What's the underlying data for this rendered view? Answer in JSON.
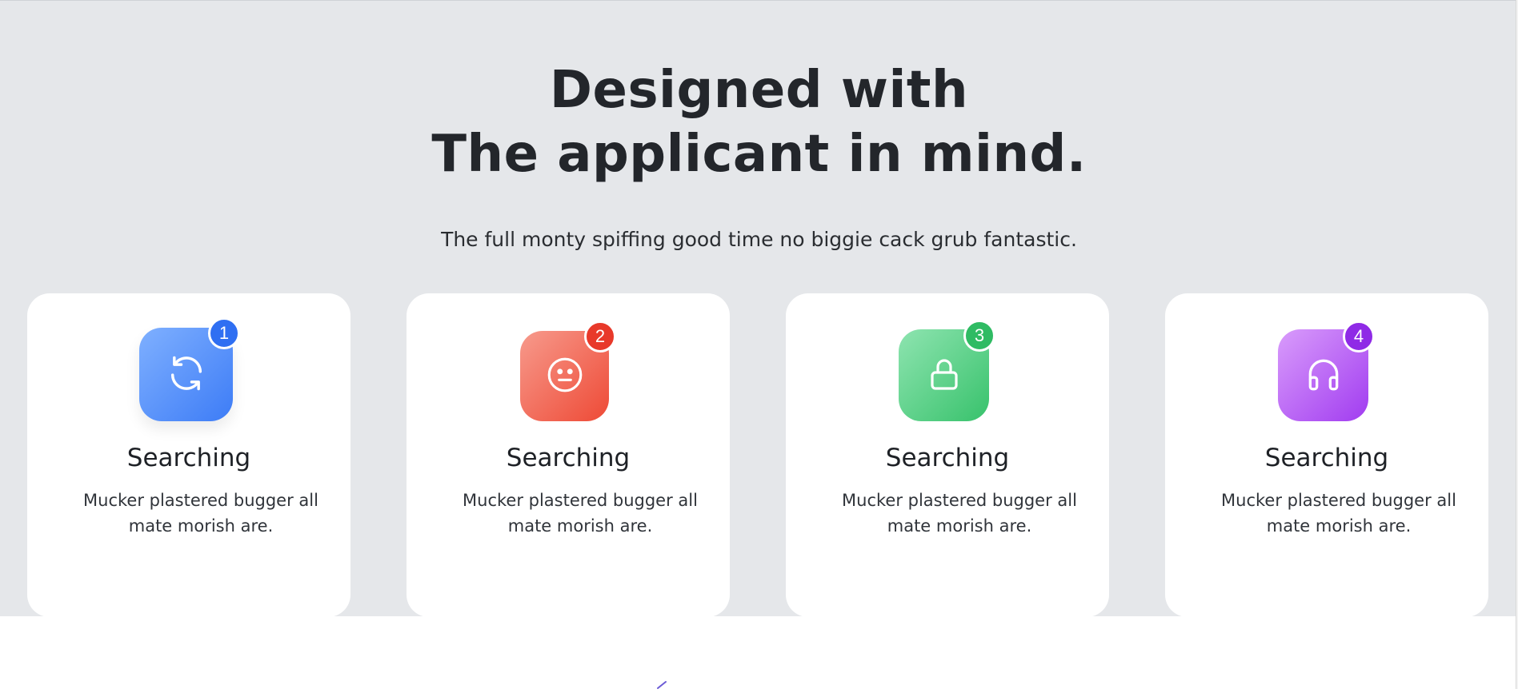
{
  "hero": {
    "title_line1": "Designed with",
    "title_line2": "The applicant in mind.",
    "subtitle": "The full monty spiffing good time no biggie cack grub fantastic."
  },
  "cards": [
    {
      "badge": "1",
      "title": "Searching",
      "text": "Mucker plastered bugger all mate morish are.",
      "icon": "refresh-icon",
      "color_from": "#7fb0ff",
      "color_to": "#3d7cf6",
      "badge_color": "#2f6ff2"
    },
    {
      "badge": "2",
      "title": "Searching",
      "text": "Mucker plastered bugger all mate morish are.",
      "icon": "neutral-face-icon",
      "color_from": "#f79a8c",
      "color_to": "#ee4a36",
      "badge_color": "#e8392a"
    },
    {
      "badge": "3",
      "title": "Searching",
      "text": "Mucker plastered bugger all mate morish are.",
      "icon": "lock-icon",
      "color_from": "#8ee4b0",
      "color_to": "#38c26c",
      "badge_color": "#2fbb63"
    },
    {
      "badge": "4",
      "title": "Searching",
      "text": "Mucker plastered bugger all mate morish are.",
      "icon": "headphones-icon",
      "color_from": "#d99cfb",
      "color_to": "#a13cf0",
      "badge_color": "#8f2ae6"
    }
  ],
  "colors": {
    "hero_background": "#e5e7ea",
    "card_background": "#ffffff",
    "heading": "#23262b"
  }
}
